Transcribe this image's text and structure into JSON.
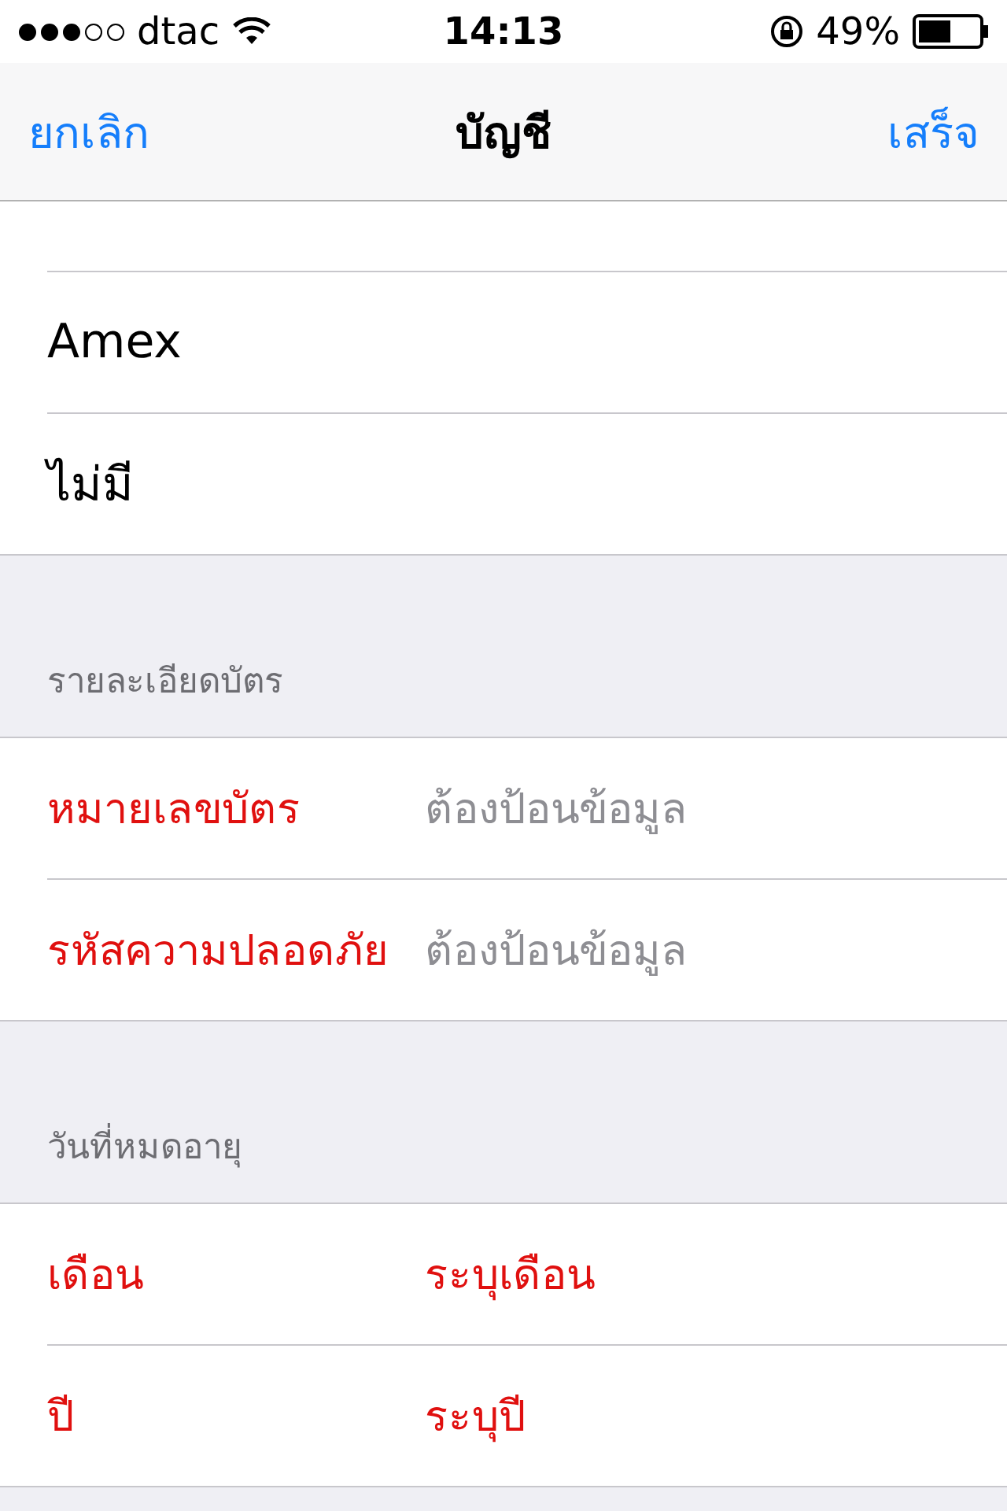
{
  "status_bar": {
    "carrier": "dtac",
    "signal_bars": [
      {
        "on": true
      },
      {
        "on": true
      },
      {
        "on": true
      },
      {
        "on": false
      },
      {
        "on": false
      }
    ],
    "time": "14:13",
    "battery_text": "49%"
  },
  "nav_bar": {
    "cancel": "ยกเลิก",
    "title": "บัญชี",
    "done": "เสร็จ"
  },
  "card_types": [
    {
      "label": "Amex"
    },
    {
      "label": "ไม่มี"
    }
  ],
  "sections": [
    {
      "header": "รายละเอียดบัตร",
      "rows": [
        {
          "kind": "field",
          "label": "หมายเลขบัตร",
          "invalid": true,
          "placeholder": "ต้องป้อนข้อมูล"
        },
        {
          "kind": "field",
          "label": "รหัสความปลอดภัย",
          "invalid": true,
          "placeholder": "ต้องป้อนข้อมูล"
        }
      ]
    },
    {
      "header": "วันที่หมดอายุ",
      "rows": [
        {
          "kind": "picker",
          "label": "เดือน",
          "invalid": true,
          "value": "ระบุเดือน"
        },
        {
          "kind": "picker",
          "label": "ปี",
          "invalid": true,
          "value": "ระบุปี"
        }
      ]
    }
  ]
}
